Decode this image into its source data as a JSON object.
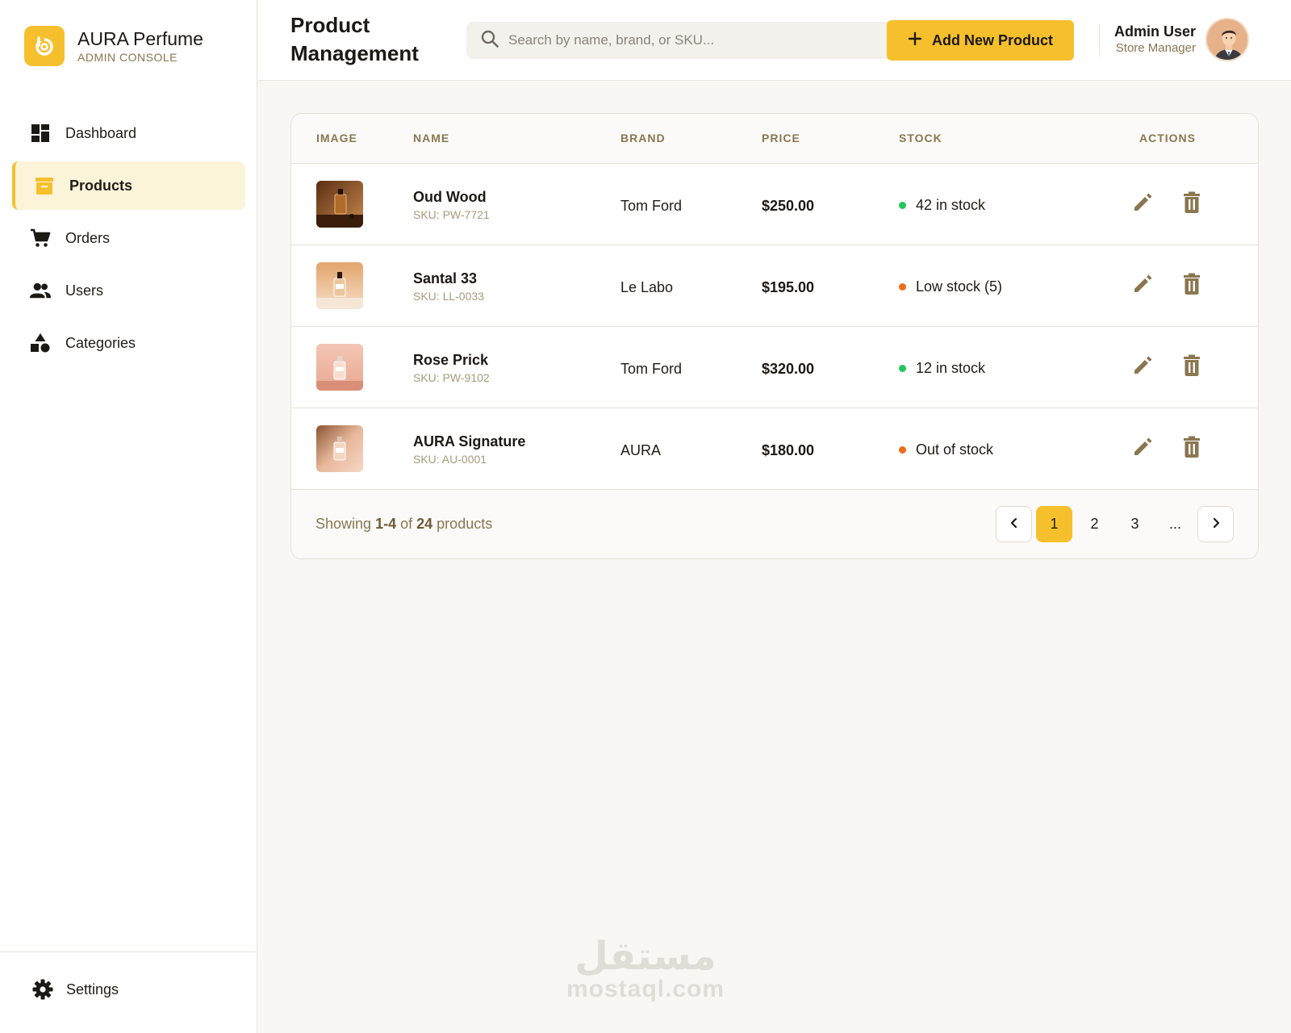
{
  "brand": {
    "name": "AURA Perfume",
    "subtitle": "ADMIN CONSOLE",
    "logo_icon": "aura-logo-icon",
    "accent": "#f6c02d"
  },
  "sidebar": {
    "items": [
      {
        "label": "Dashboard",
        "icon": "dashboard-icon",
        "active": false
      },
      {
        "label": "Products",
        "icon": "archive-box-icon",
        "active": true
      },
      {
        "label": "Orders",
        "icon": "cart-icon",
        "active": false
      },
      {
        "label": "Users",
        "icon": "users-icon",
        "active": false
      },
      {
        "label": "Categories",
        "icon": "shapes-icon",
        "active": false
      }
    ],
    "settings": {
      "label": "Settings",
      "icon": "gear-icon"
    }
  },
  "header": {
    "title": "Product Management",
    "search_placeholder": "Search by name, brand, or SKU...",
    "add_button": "Add New Product",
    "user": {
      "name": "Admin User",
      "role": "Store Manager"
    }
  },
  "table": {
    "columns": [
      "IMAGE",
      "NAME",
      "BRAND",
      "PRICE",
      "STOCK",
      "ACTIONS"
    ],
    "rows": [
      {
        "name": "Oud Wood",
        "sku": "SKU: PW-7721",
        "brand": "Tom Ford",
        "price": "$250.00",
        "stock": "42 in stock",
        "stock_status": "in-stock",
        "status_color": "#22c55e"
      },
      {
        "name": "Santal 33",
        "sku": "SKU: LL-0033",
        "brand": "Le Labo",
        "price": "$195.00",
        "stock": "Low stock (5)",
        "stock_status": "low-stock",
        "status_color": "#f06a1d"
      },
      {
        "name": "Rose Prick",
        "sku": "SKU: PW-9102",
        "brand": "Tom Ford",
        "price": "$320.00",
        "stock": "12 in stock",
        "stock_status": "in-stock",
        "status_color": "#22c55e"
      },
      {
        "name": "AURA Signature",
        "sku": "SKU: AU-0001",
        "brand": "AURA",
        "price": "$180.00",
        "stock": "Out of stock",
        "stock_status": "out-of-stock",
        "status_color": "#f06a1d"
      }
    ]
  },
  "footer": {
    "showing_prefix": "Showing",
    "showing_range": "1-4",
    "showing_of": "of",
    "showing_total": "24",
    "showing_suffix": "products",
    "pages": [
      "1",
      "2",
      "3",
      "..."
    ],
    "current_page": "1"
  },
  "watermark": {
    "arabic": "مستقل",
    "latin": "mostaql.com"
  }
}
